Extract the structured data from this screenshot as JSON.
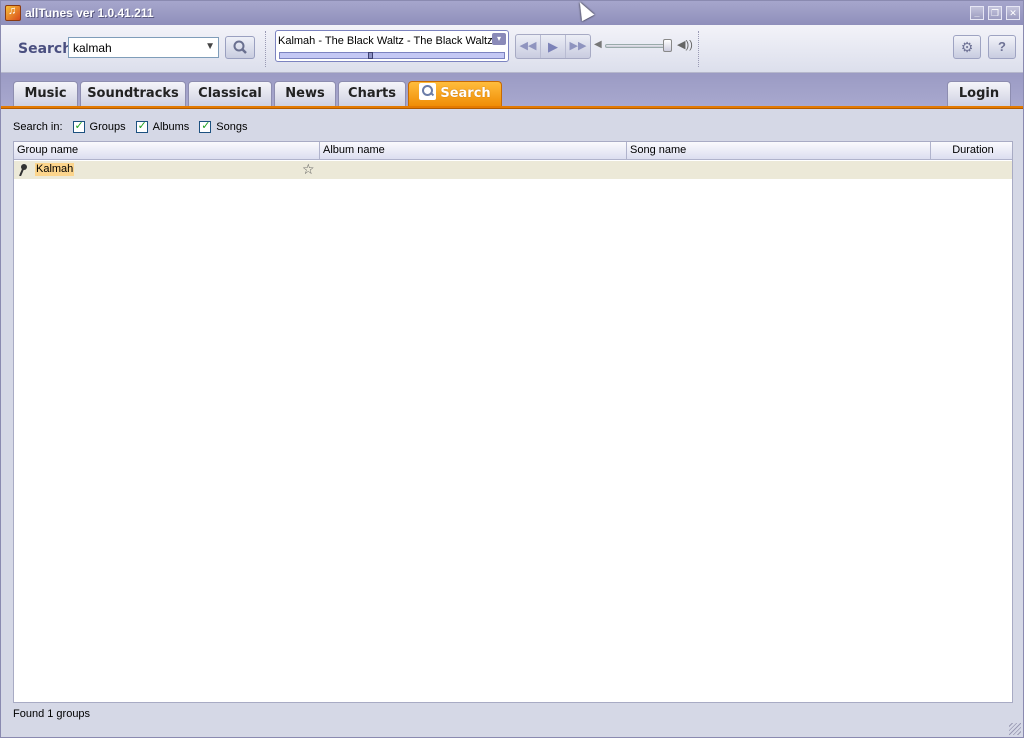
{
  "window": {
    "title": "allTunes ver 1.0.41.211",
    "controls": {
      "minimize": "_",
      "maximize": "❐",
      "close": "✕"
    }
  },
  "toolbar": {
    "search_label": "Search",
    "search_value": "kalmah",
    "search_placeholder": "",
    "combo_arrow": "▼",
    "search_button_icon": "magnifier-icon",
    "now_playing": {
      "text": "Kalmah - The Black Waltz - The Black Waltz",
      "menu_icon": "▾",
      "progress_fraction": 0.4
    },
    "transport": {
      "rewind": "◀◀",
      "play": "▶",
      "forward": "▶▶"
    },
    "volume": {
      "low_icon": "◀",
      "high_icon": "◀))",
      "level_fraction": 1.0
    },
    "settings_icon": "⚙",
    "help_label": "?"
  },
  "tabs": [
    {
      "label": "Music",
      "active": false
    },
    {
      "label": "Soundtracks",
      "active": false
    },
    {
      "label": "Classical",
      "active": false
    },
    {
      "label": "News",
      "active": false
    },
    {
      "label": "Charts",
      "active": false
    },
    {
      "label": "Search",
      "active": true
    }
  ],
  "login_label": "Login",
  "search_in": {
    "label": "Search in:",
    "options": [
      {
        "label": "Groups",
        "checked": true
      },
      {
        "label": "Albums",
        "checked": true
      },
      {
        "label": "Songs",
        "checked": true
      }
    ]
  },
  "results": {
    "columns": [
      "Group name",
      "Album name",
      "Song name",
      "Duration"
    ],
    "rows": [
      {
        "group": "Kalmah",
        "album": "",
        "song": "",
        "duration": "",
        "row_icon": "microphone-icon",
        "favorite_icon": "☆"
      }
    ]
  },
  "status": "Found 1 groups",
  "colors": {
    "accent_orange": "#f08d05",
    "title_purple": "#8f8fbb",
    "row_highlight": "#fcd58c"
  }
}
